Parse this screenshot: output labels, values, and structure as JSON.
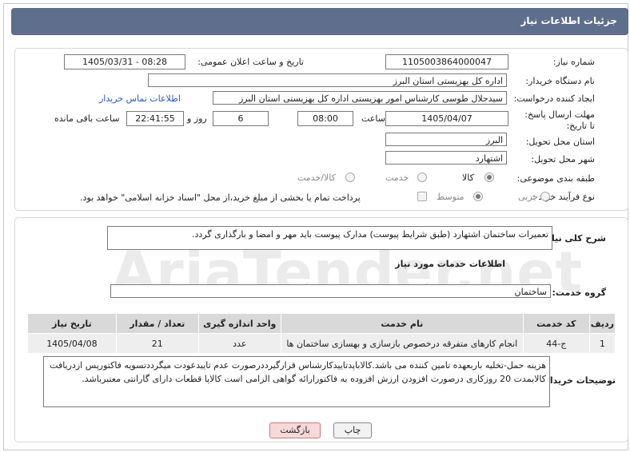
{
  "header": {
    "title": "جزئیات اطلاعات نیاز"
  },
  "fields": {
    "need_number_label": "شماره نیاز:",
    "need_number": "1105003864000047",
    "announce_label": "تاریخ و ساعت اعلان عمومی:",
    "announce_value": "1405/03/31 - 08:28",
    "buyer_org_label": "نام دستگاه خریدار:",
    "buyer_org": "اداره کل بهزیستی استان البرز",
    "creator_label": "ایجاد کننده درخواست:",
    "creator": "سیدجلال طوسی کارشناس امور بهزیستی اداره کل بهزیستی استان البرز",
    "contact_link": "اطلاعات تماس خریدار",
    "deadline_label": "مهلت ارسال پاسخ: تا تاریخ:",
    "deadline_date": "1405/04/07",
    "time_label": "ساعت",
    "deadline_time": "08:00",
    "days_value": "6",
    "days_label": "روز و",
    "remaining_time": "22:41:55",
    "remaining_label": "ساعت باقی مانده",
    "province_label": "استان محل تحویل:",
    "province": "البرز",
    "city_label": "شهر محل تحویل:",
    "city": "اشتهارد",
    "category_label": "طبقه بندی موضوعی:",
    "category_options": [
      "کالا",
      "خدمت",
      "کالا/خدمت"
    ],
    "purchase_type_label": "نوع فرآیند خرید :",
    "purchase_options": [
      "جزیی",
      "متوسط"
    ],
    "payment_note": "پرداخت تمام یا بخشی از مبلغ خرید،از محل \"اسناد خزانه اسلامی\" خواهد بود."
  },
  "summary": {
    "label": "شرح کلی نیاز:",
    "text": "تعمیرات ساختمان اشتهارد (طبق شرایط پیوست) مدارک پیوست باید مهر و امضا و بارگذاری گردد."
  },
  "services": {
    "heading": "اطلاعات خدمات مورد نیاز",
    "group_label": "گروه خدمت:",
    "group_value": "ساختمان",
    "columns": [
      "ردیف",
      "کد خدمت",
      "نام خدمت",
      "واحد اندازه گیری",
      "تعداد / مقدار",
      "تاریخ نیاز"
    ],
    "rows": [
      [
        "1",
        "ج-44",
        "انجام کارهای متفرقه درخصوص بازسازی و بهسازی ساختمان ها",
        "عدد",
        "21",
        "1405/04/08"
      ]
    ]
  },
  "buyer_notes": {
    "label": "توضیحات خریدار:",
    "text": "هزینه حمل-تخلیه باربعهده تامین کننده می باشد.کالاباپدتاییدکارشناس قرارگیرددرصورت عدم تاییدعودت میگرددتسویه فاکتورپس ازدریافت کالابمدت 20 روزکاری درصورت افزودن ارزش افزوده به فاکتورارائه گواهی الزامی است کالاپا قطعات دارای گارانتی معتبرباشد."
  },
  "buttons": {
    "print": "چاپ",
    "back": "بازگشت"
  },
  "watermark": "AriaTender.net"
}
